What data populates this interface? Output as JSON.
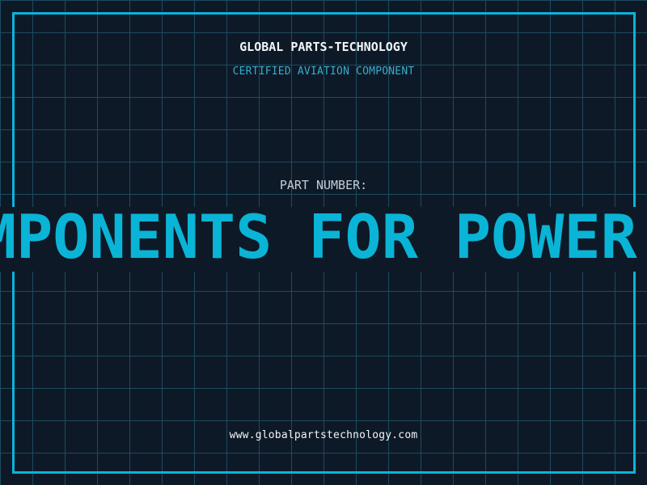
{
  "header": {
    "title": "GLOBAL PARTS-TECHNOLOGY",
    "subtitle": "CERTIFIED AVIATION COMPONENT"
  },
  "part": {
    "label": "PART NUMBER:"
  },
  "marquee": {
    "visible_text": "MPONENTS FOR POWER"
  },
  "footer": {
    "url": "www.globalpartstechnology.com"
  },
  "colors": {
    "background": "#0e1927",
    "grid_line": "#1d4a5e",
    "frame_border": "#08b4dc",
    "marquee_accent": "#0ab4d6",
    "subtitle_cyan": "#35aecd",
    "title_white": "#f2f5f7",
    "label_gray": "#c7ccd5"
  }
}
